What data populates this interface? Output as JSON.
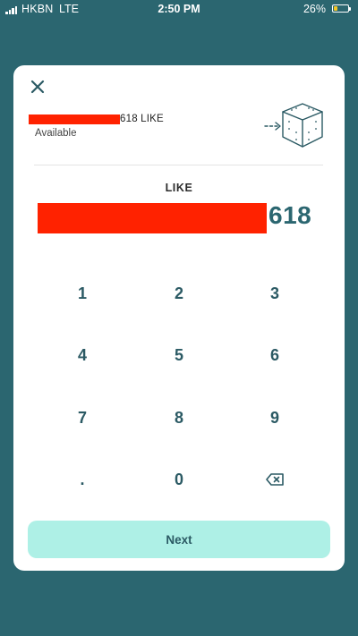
{
  "status_bar": {
    "carrier": "HKBN",
    "network": "LTE",
    "time": "2:50 PM",
    "battery_percent": "26%",
    "battery_level": 0.26,
    "battery_color": "#f3c623"
  },
  "colors": {
    "background": "#2b6670",
    "card": "#ffffff",
    "accent": "#2b6670",
    "redaction": "#ff2200",
    "next_button": "#aef0e6"
  },
  "header": {
    "close_icon": "close-icon",
    "balance": "618 LIKE",
    "available_label": "Available",
    "illustration_icon": "box-transfer-icon"
  },
  "amount": {
    "currency": "LIKE",
    "value": "618"
  },
  "keypad": {
    "k1": "1",
    "k2": "2",
    "k3": "3",
    "k4": "4",
    "k5": "5",
    "k6": "6",
    "k7": "7",
    "k8": "8",
    "k9": "9",
    "dot": ".",
    "k0": "0",
    "backspace_icon": "backspace-icon"
  },
  "next_button": {
    "label": "Next"
  }
}
